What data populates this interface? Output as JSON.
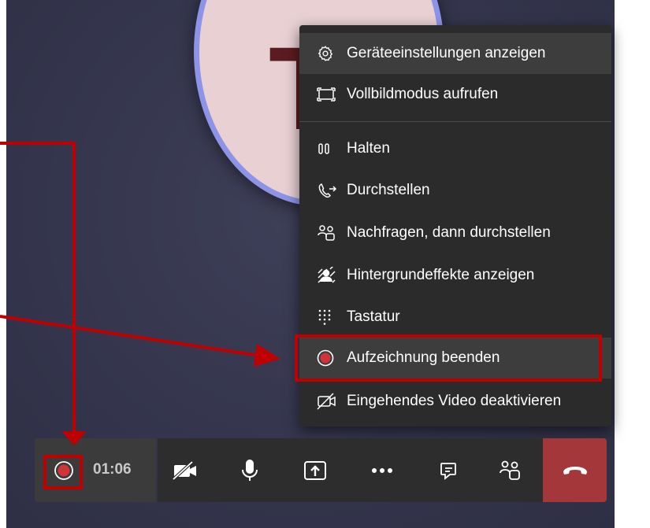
{
  "avatar": {
    "initials": "T"
  },
  "menu": {
    "items": [
      {
        "label": "Geräteeinstellungen anzeigen",
        "icon": "gear-icon"
      },
      {
        "label": "Vollbildmodus aufrufen",
        "icon": "fullscreen-icon"
      },
      {
        "label": "Halten",
        "icon": "pause-icon"
      },
      {
        "label": "Durchstellen",
        "icon": "call-transfer-icon"
      },
      {
        "label": "Nachfragen, dann durchstellen",
        "icon": "people-icon"
      },
      {
        "label": "Hintergrundeffekte anzeigen",
        "icon": "background-effects-icon"
      },
      {
        "label": "Tastatur",
        "icon": "dialpad-icon"
      },
      {
        "label": "Aufzeichnung beenden",
        "icon": "record-stop-icon"
      },
      {
        "label": "Eingehendes Video deaktivieren",
        "icon": "video-off-icon"
      }
    ]
  },
  "toolbar": {
    "timer": "01:06"
  },
  "colors": {
    "annotation": "#c00000",
    "record": "#d13438",
    "hangup": "#a4373a",
    "avatar_ring": "#8d94e8"
  }
}
